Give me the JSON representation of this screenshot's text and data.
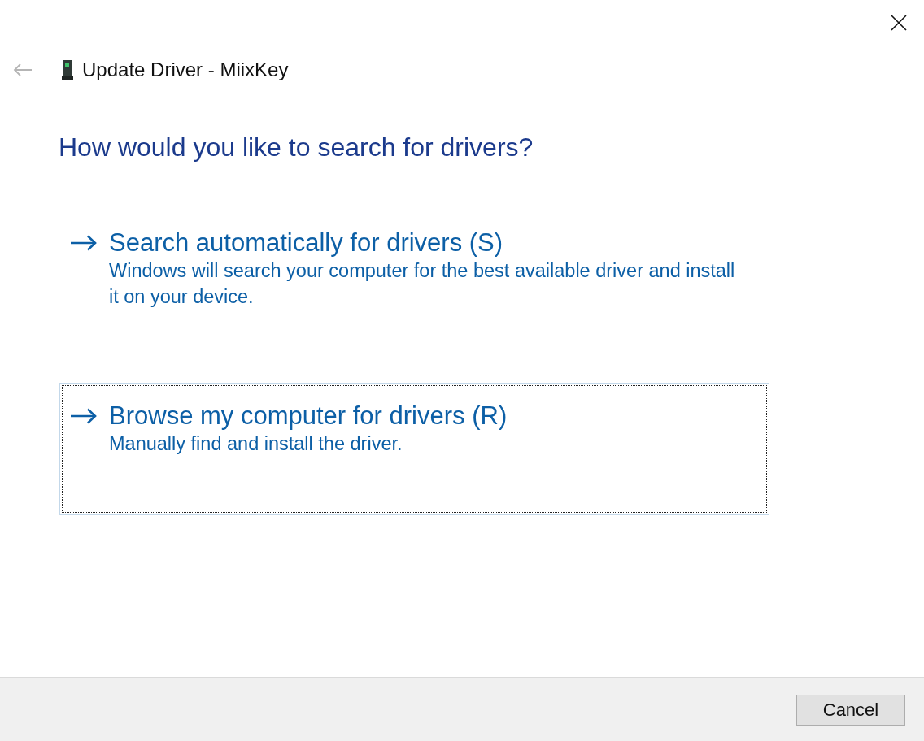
{
  "window": {
    "title": "Update Driver - MiixKey",
    "back_button": {
      "disabled": true
    }
  },
  "heading": "How would you like to search for drivers?",
  "options": [
    {
      "title": "Search automatically for drivers (S)",
      "description": "Windows will search your computer for the best available driver and install it on your device.",
      "selected": false
    },
    {
      "title": "Browse my computer for drivers (R)",
      "description": "Manually find and install the driver.",
      "selected": true
    }
  ],
  "buttons": [
    {
      "label": "Cancel"
    }
  ]
}
